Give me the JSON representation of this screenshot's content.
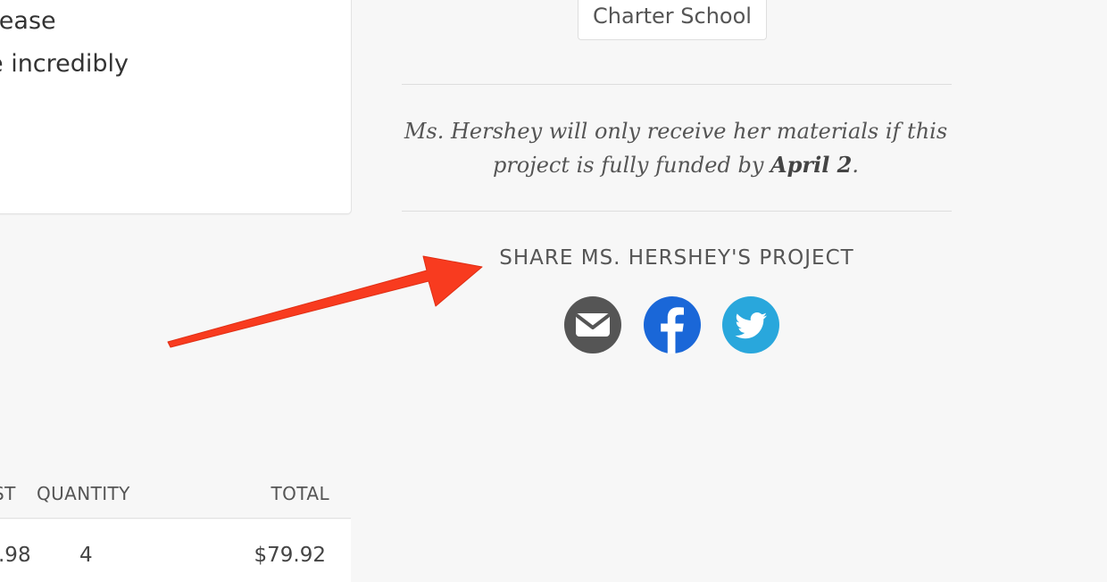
{
  "description": {
    "line1": "Please",
    "line2": "e incredibly"
  },
  "materials_table": {
    "headers": {
      "cost": "ST",
      "quantity": "QUANTITY",
      "total": "TOTAL"
    },
    "rows": [
      {
        "cost": ".98",
        "quantity": "4",
        "total": "$79.92"
      }
    ]
  },
  "school_tag": "Charter School",
  "deadline": {
    "prefix": "Ms. Hershey will only receive her materials if this project is fully funded by ",
    "date": "April 2",
    "suffix": "."
  },
  "share": {
    "title": "SHARE MS. HERSHEY'S PROJECT",
    "buttons": [
      {
        "name": "email",
        "icon": "envelope-icon",
        "color": "#555555"
      },
      {
        "name": "facebook",
        "icon": "facebook-icon",
        "color": "#1a67d8"
      },
      {
        "name": "twitter",
        "icon": "twitter-bird-icon",
        "color": "#29a7dc"
      }
    ]
  },
  "annotation": {
    "arrow_color": "#f83b1f"
  }
}
